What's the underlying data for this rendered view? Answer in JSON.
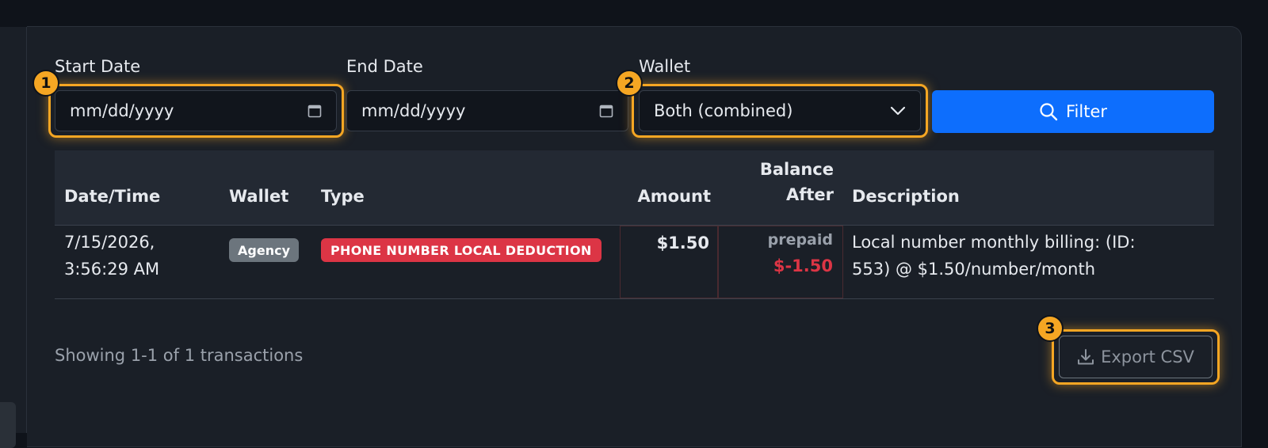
{
  "filters": {
    "start_date": {
      "label": "Start Date",
      "placeholder": "mm/dd/yyyy"
    },
    "end_date": {
      "label": "End Date",
      "placeholder": "mm/dd/yyyy"
    },
    "wallet": {
      "label": "Wallet",
      "selected": "Both (combined)"
    },
    "filter_button": "Filter"
  },
  "table": {
    "columns": {
      "datetime": "Date/Time",
      "wallet": "Wallet",
      "type": "Type",
      "amount": "Amount",
      "balance_line1": "Balance",
      "balance_line2": "After",
      "description": "Description"
    },
    "rows": [
      {
        "datetime_line1": "7/15/2026,",
        "datetime_line2": "3:56:29 AM",
        "wallet": "Agency",
        "type": "PHONE NUMBER LOCAL DEDUCTION",
        "amount": "$1.50",
        "balance_wallet": "prepaid",
        "balance_value": "$-1.50",
        "description_line1": "Local number monthly billing: (ID:",
        "description_line2": "553) @ $1.50/number/month"
      }
    ]
  },
  "footer": {
    "showing": "Showing 1-1 of 1 transactions",
    "export_button": "Export CSV"
  },
  "annotations": {
    "badge1": "1",
    "badge2": "2",
    "badge3": "3"
  },
  "colors": {
    "accent_highlight": "#f5a623",
    "primary": "#0d6efd",
    "danger": "#dc3545",
    "secondary": "#6c757d"
  }
}
